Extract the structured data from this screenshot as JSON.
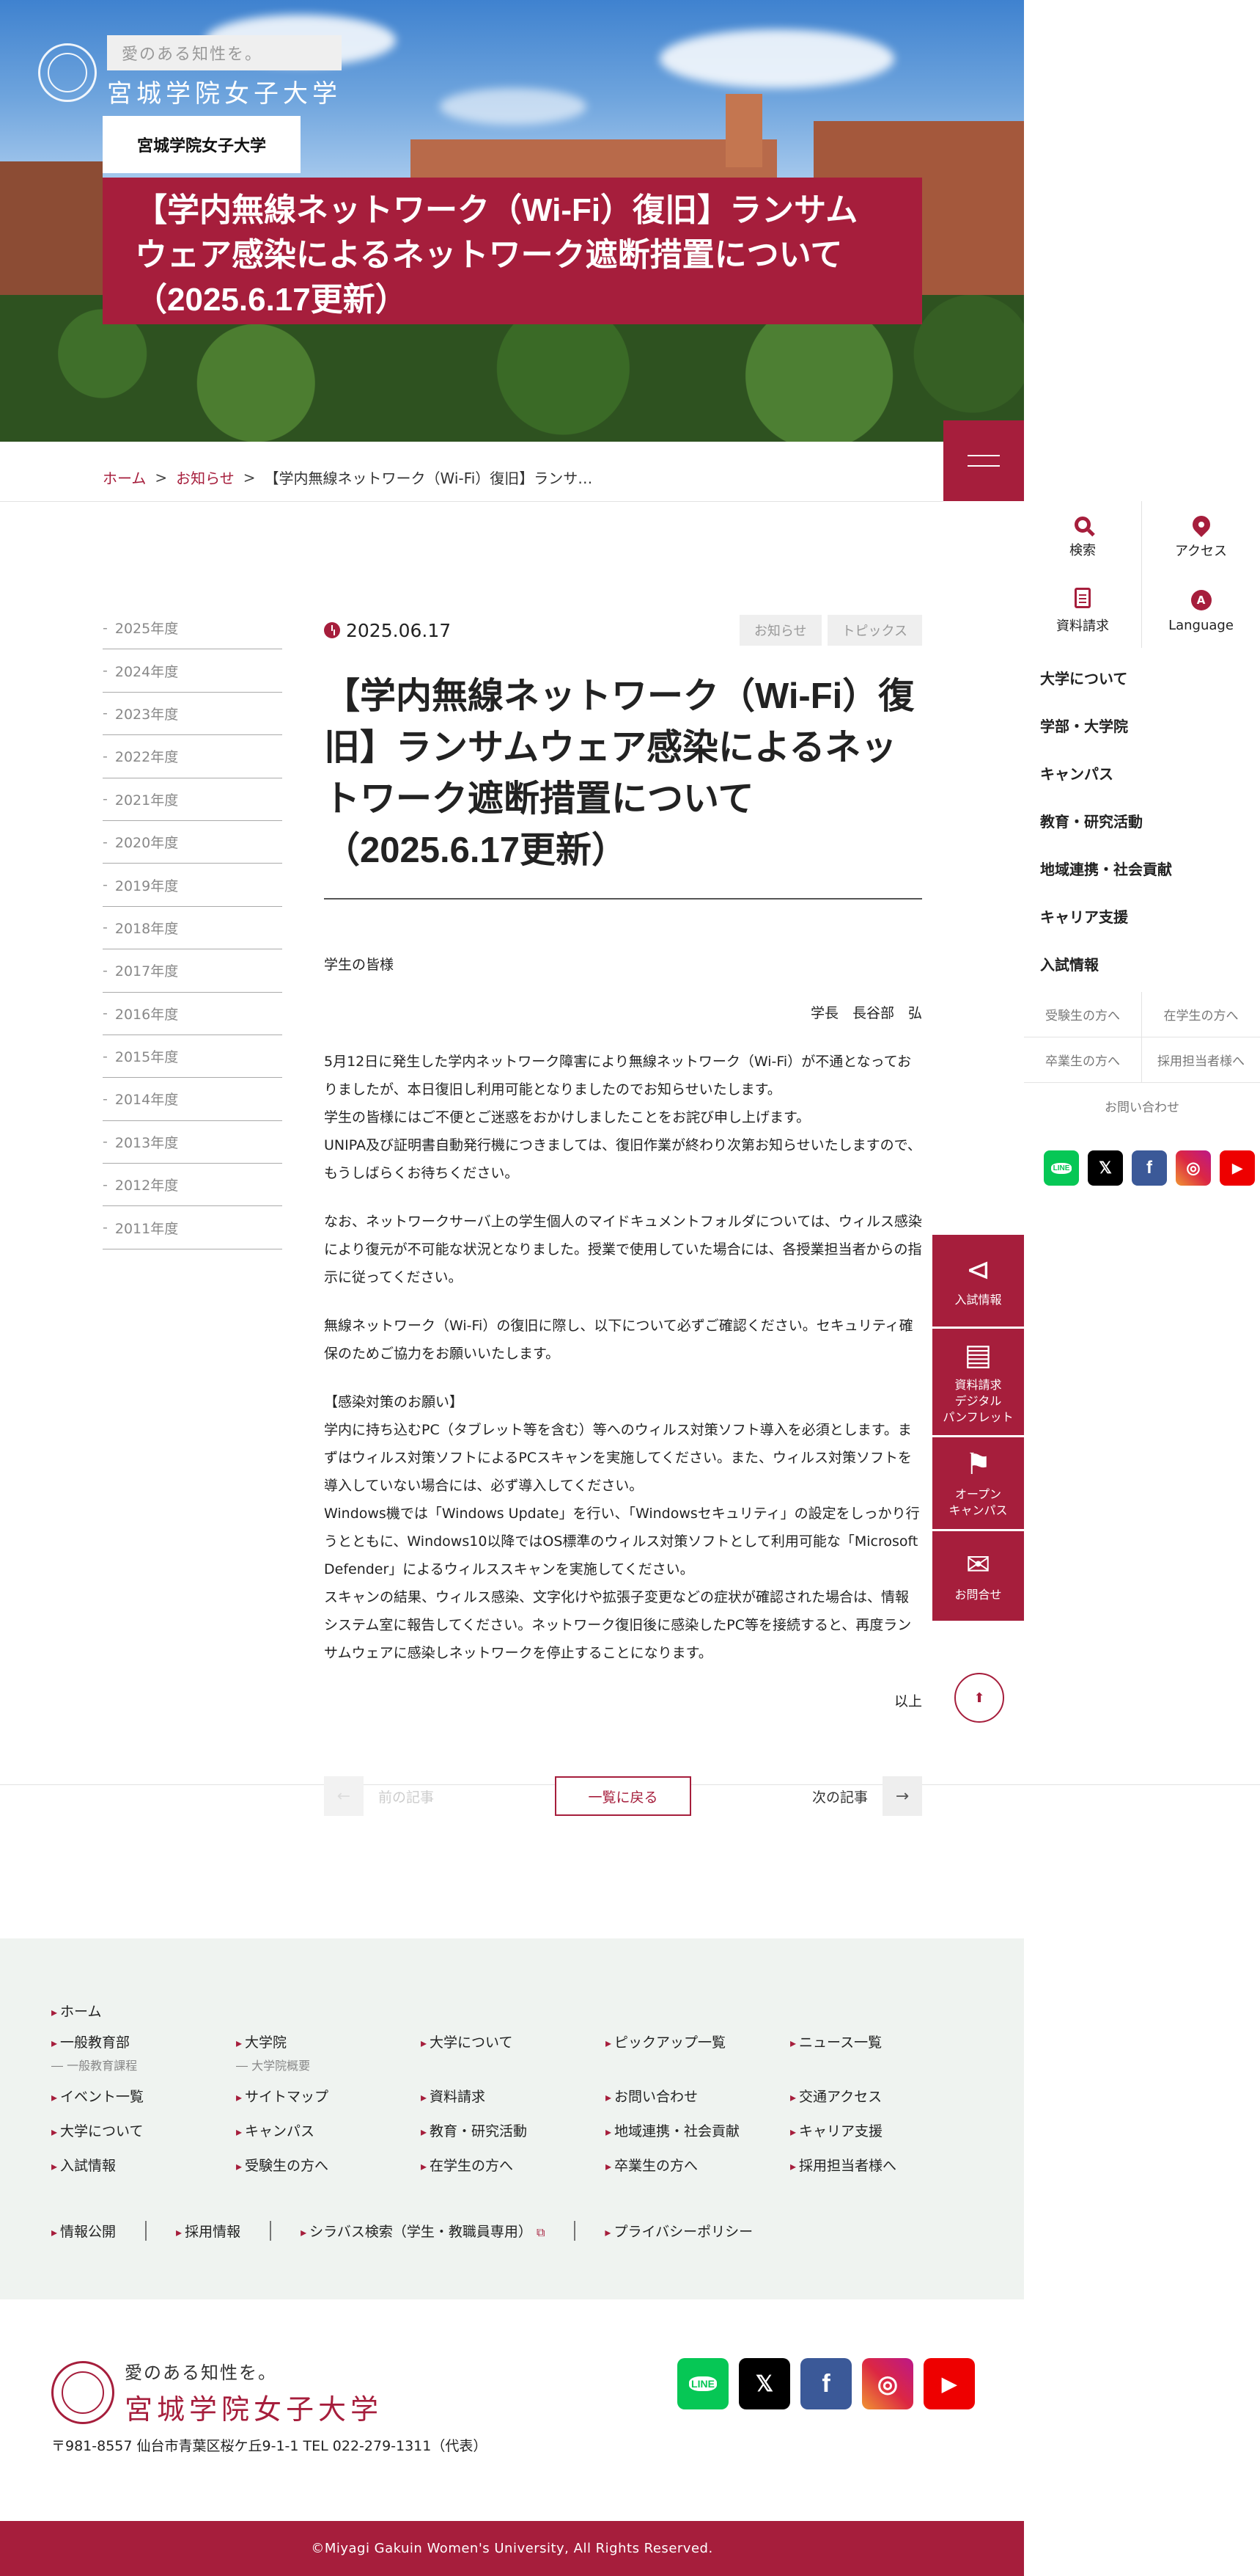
{
  "hero": {
    "tagline": "愛のある知性を。",
    "university": "宮城学院女子大学",
    "label": "宮城学院女子大学",
    "title": "【学内無線ネットワーク（Wi-Fi）復旧】ランサムウェア感染によるネットワーク遮断措置について（2025.6.17更新）"
  },
  "breadcrumb": {
    "home": "ホーム",
    "news": "お知らせ",
    "current": "【学内無線ネットワーク（Wi-Fi）復旧】ランサ…"
  },
  "sidebar": {
    "tools": [
      {
        "label": "検索",
        "icon": "search-icon"
      },
      {
        "label": "アクセス",
        "icon": "map-pin-icon"
      },
      {
        "label": "資料請求",
        "icon": "document-icon"
      },
      {
        "label": "Language",
        "icon": "language-icon",
        "glyph": "A"
      }
    ],
    "menu": [
      "大学について",
      "学部・大学院",
      "キャンパス",
      "教育・研究活動",
      "地域連携・社会貢献",
      "キャリア支援",
      "入試情報"
    ],
    "subs": [
      "受験生の方へ",
      "在学生の方へ",
      "卒業生の方へ",
      "採用担当者様へ"
    ],
    "contact": "お問い合わせ",
    "social": [
      {
        "name": "line-icon",
        "text": "LINE"
      },
      {
        "name": "x-icon",
        "text": "𝕏"
      },
      {
        "name": "facebook-icon",
        "text": "f"
      },
      {
        "name": "instagram-icon",
        "text": "◎"
      },
      {
        "name": "youtube-icon",
        "text": "▶"
      }
    ]
  },
  "floating": [
    {
      "label": "入試情報",
      "icon": "megaphone-icon",
      "glyph": "⊲"
    },
    {
      "label": "資料請求\nデジタル\nパンフレット",
      "icon": "document-icon",
      "glyph": "▤"
    },
    {
      "label": "オープン\nキャンパス",
      "icon": "flag-icon",
      "glyph": "⚑"
    },
    {
      "label": "お問合せ",
      "icon": "mail-icon",
      "glyph": "✉"
    }
  ],
  "years": [
    "2025年度",
    "2024年度",
    "2023年度",
    "2022年度",
    "2021年度",
    "2020年度",
    "2019年度",
    "2018年度",
    "2017年度",
    "2016年度",
    "2015年度",
    "2014年度",
    "2013年度",
    "2012年度",
    "2011年度"
  ],
  "article": {
    "date": "2025.06.17",
    "tags": [
      "お知らせ",
      "トピックス"
    ],
    "title": "【学内無線ネットワーク（Wi-Fi）復旧】ランサムウェア感染によるネットワーク遮断措置について（2025.6.17更新）",
    "greeting": "学生の皆様",
    "signer": "学長　長谷部　弘",
    "p1": [
      "5月12日に発生した学内ネットワーク障害により無線ネットワーク（Wi-Fi）が不通となっておりましたが、本日復旧し利用可能となりましたのでお知らせいたします。",
      "学生の皆様にはご不便とご迷惑をおかけしましたことをお詫び申し上げます。",
      "UNIPA及び証明書自動発行機につきましては、復旧作業が終わり次第お知らせいたしますので、もうしばらくお待ちください。"
    ],
    "p2": "なお、ネットワークサーバ上の学生個人のマイドキュメントフォルダについては、ウィルス感染により復元が不可能な状況となりました。授業で使用していた場合には、各授業担当者からの指示に従ってください。",
    "p3": "無線ネットワーク（Wi-Fi）の復旧に際し、以下について必ずご確認ください。セキュリティ確保のためご協力をお願いいたします。",
    "p4": [
      "【感染対策のお願い】",
      "学内に持ち込むPC（タブレット等を含む）等へのウィルス対策ソフト導入を必須とします。まずはウィルス対策ソフトによるPCスキャンを実施してください。また、ウィルス対策ソフトを導入していない場合には、必ず導入してください。",
      "Windows機では「Windows Update」を行い、「Windowsセキュリティ」の設定をしっかり行うとともに、Windows10以降ではOS標準のウィルス対策ソフトとして利用可能な「Microsoft Defender」によるウィルススキャンを実施してください。",
      "スキャンの結果、ウィルス感染、文字化けや拡張子変更などの症状が確認された場合は、情報システム室に報告してください。ネットワーク復旧後に感染したPC等を接続すると、再度ランサムウェアに感染しネットワークを停止することになります。"
    ],
    "closing": "以上"
  },
  "pager": {
    "prev": "前の記事",
    "back": "一覧に戻る",
    "next": "次の記事"
  },
  "footer": {
    "home": "ホーム",
    "links": [
      {
        "label": "一般教育部",
        "sub": "一般教育課程"
      },
      {
        "label": "大学院",
        "sub": "大学院概要"
      },
      {
        "label": "大学について"
      },
      {
        "label": "ピックアップ一覧"
      },
      {
        "label": "ニュース一覧"
      },
      {
        "label": "イベント一覧"
      },
      {
        "label": "サイトマップ"
      },
      {
        "label": "資料請求"
      },
      {
        "label": "お問い合わせ"
      },
      {
        "label": "交通アクセス"
      },
      {
        "label": "大学について"
      },
      {
        "label": "キャンパス"
      },
      {
        "label": "教育・研究活動"
      },
      {
        "label": "地域連携・社会貢献"
      },
      {
        "label": "キャリア支援"
      },
      {
        "label": "入試情報"
      },
      {
        "label": "受験生の方へ"
      },
      {
        "label": "在学生の方へ"
      },
      {
        "label": "卒業生の方へ"
      },
      {
        "label": "採用担当者様へ"
      }
    ],
    "bottom": [
      "情報公開",
      "採用情報",
      "シラバス検索（学生・教職員専用）",
      "プライバシーポリシー"
    ],
    "tagline": "愛のある知性を。",
    "university": "宮城学院女子大学",
    "address": "〒981-8557 仙台市青葉区桜ケ丘9-1-1 TEL 022-279-1311（代表）",
    "copyright": "©Miyagi Gakuin Women's University, All Rights Reserved."
  },
  "colors": {
    "accent": "#a61e3c",
    "footer_bg": "#eff3f0"
  }
}
